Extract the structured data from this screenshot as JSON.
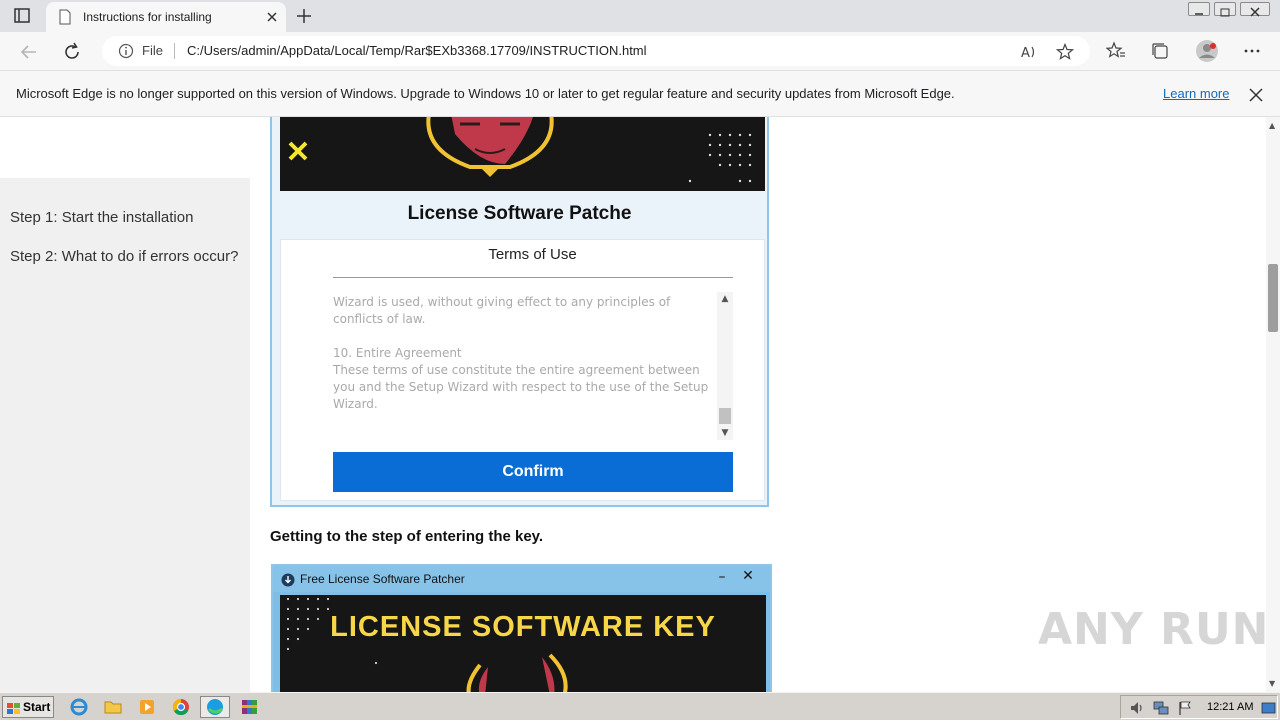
{
  "browser": {
    "tab_title": "Instructions for installing",
    "address_scheme": "File",
    "url": "C:/Users/admin/AppData/Local/Temp/Rar$EXb3368.17709/INSTRUCTION.html",
    "colors": {
      "tab_strip": "#dfe1e5",
      "toolbar": "#f7f7f7",
      "link": "#0f6cbd"
    }
  },
  "infobar": {
    "message": "Microsoft Edge is no longer supported on this version of Windows. Upgrade to Windows 10 or later to get regular feature and security updates from Microsoft Edge.",
    "link": "Learn more"
  },
  "sidebar": {
    "steps": [
      {
        "label": "Step 1: Start the installation"
      },
      {
        "label": "Step 2: What to do if errors occur?"
      }
    ]
  },
  "card1": {
    "title": "License Software Patche",
    "terms_title": "Terms of Use",
    "terms_paragraphs": [
      "Wizard is used, without giving effect to any principles of conflicts of law.",
      "10. Entire Agreement\nThese terms of use constitute the entire agreement between you and the Setup Wizard with respect to the use of the Setup Wizard."
    ],
    "confirm_label": "Confirm",
    "colors": {
      "button": "#0a6dd6",
      "border": "#8ec5e8"
    }
  },
  "step_note": "Getting to the step of entering the key.",
  "card2": {
    "window_title": "Free License Software Patcher",
    "minimize": "–",
    "close": "✕",
    "banner_text": "LICENSE SOFTWARE KEY",
    "colors": {
      "banner_text": "#f7d64a"
    }
  },
  "watermark": "ANY RUN",
  "taskbar": {
    "start_label": "Start",
    "clock": "12:21 AM",
    "apps": [
      "ie-icon",
      "folder-icon",
      "media-player-icon",
      "chrome-icon",
      "edge-icon",
      "winrar-icon"
    ]
  }
}
